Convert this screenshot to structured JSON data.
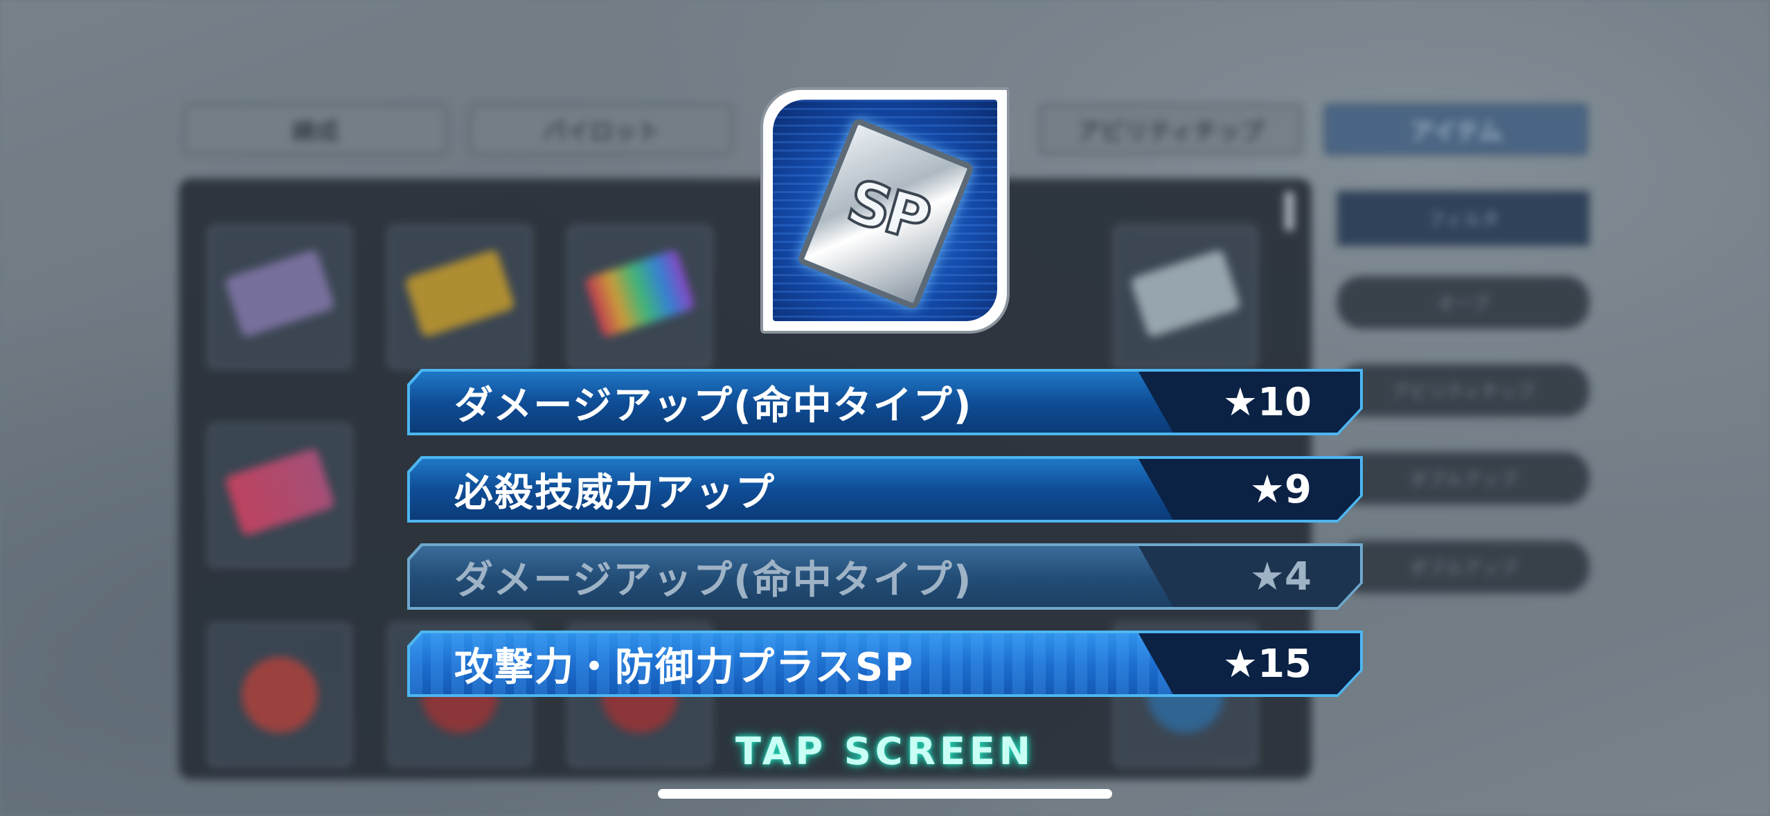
{
  "background": {
    "tabs": [
      {
        "label": "練成",
        "active": false
      },
      {
        "label": "パイロット",
        "active": false
      },
      {
        "label": "",
        "active": false
      },
      {
        "label": "アビリティチップ",
        "active": false
      },
      {
        "label": "アイテム",
        "active": true
      }
    ],
    "side": {
      "filter_label": "フィルタ",
      "buttons": [
        "オーブ",
        "アビリティチップ",
        "ダブルアップ",
        "ダブルアップ"
      ]
    }
  },
  "item": {
    "icon": "sp-ability-chip-icon",
    "icon_text": "SP"
  },
  "abilities": [
    {
      "name": "ダメージアップ(命中タイプ)",
      "rank": "★10",
      "state": "normal"
    },
    {
      "name": "必殺技威力アップ",
      "rank": "★9",
      "state": "normal"
    },
    {
      "name": "ダメージアップ(命中タイプ)",
      "rank": "★4",
      "state": "dimmed"
    },
    {
      "name": "攻撃力・防御力プラスSP",
      "rank": "★15",
      "state": "highlight"
    }
  ],
  "prompt": {
    "tap_label": "TAP SCREEN"
  },
  "colors": {
    "row_border": "#4db6f0",
    "row_fill": "#0f4d96",
    "rank_fill": "#0b2245",
    "tap_glow": "#2fe3c6"
  }
}
